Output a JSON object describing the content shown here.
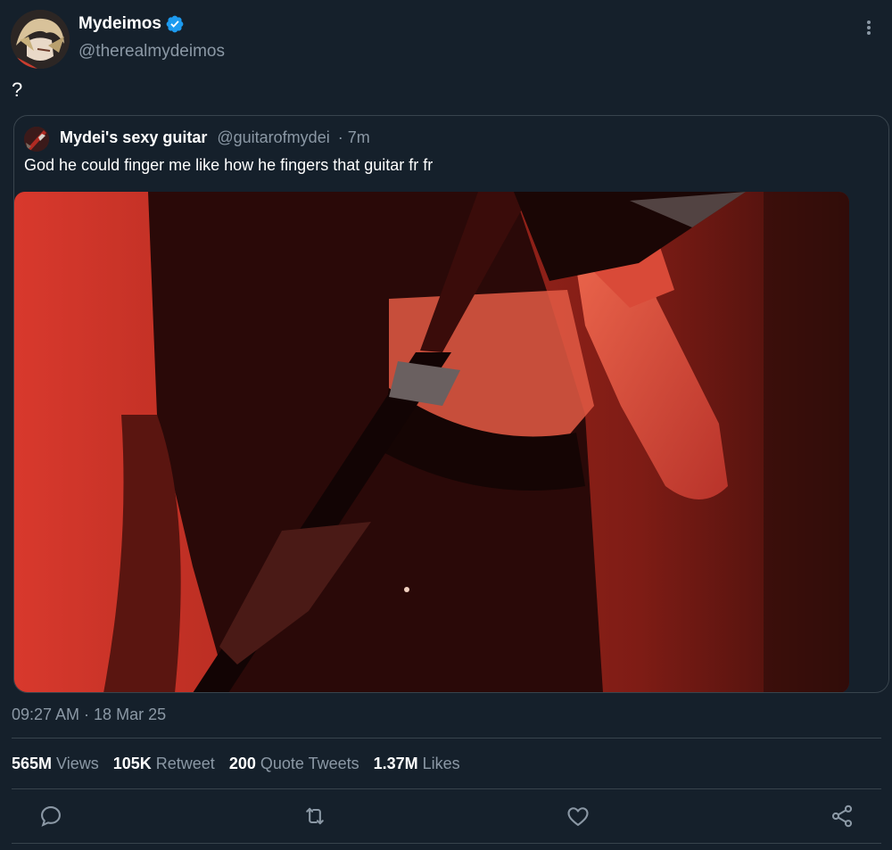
{
  "tweet": {
    "author": {
      "display_name": "Mydeimos",
      "handle": "@therealmydeimos",
      "verified": true
    },
    "text": "?",
    "timestamp": "09:27 AM · 18 Mar 25"
  },
  "quoted": {
    "display_name": "Mydei's sexy guitar",
    "handle": "@guitarofmydei",
    "age": "· 7m",
    "text": "God he could finger me like how he fingers that guitar fr fr"
  },
  "stats": [
    {
      "count": "565M",
      "label": "Views"
    },
    {
      "count": "105K",
      "label": "Retweet"
    },
    {
      "count": "200",
      "label": "Quote Tweets"
    },
    {
      "count": "1.37M",
      "label": "Likes"
    }
  ],
  "actions": [
    "reply-icon",
    "retweet-icon",
    "like-icon",
    "share-icon"
  ],
  "colors": {
    "background": "#15202b",
    "border": "#38444d",
    "secondary_text": "#8b98a5",
    "verified_blue": "#1d9bf0"
  }
}
